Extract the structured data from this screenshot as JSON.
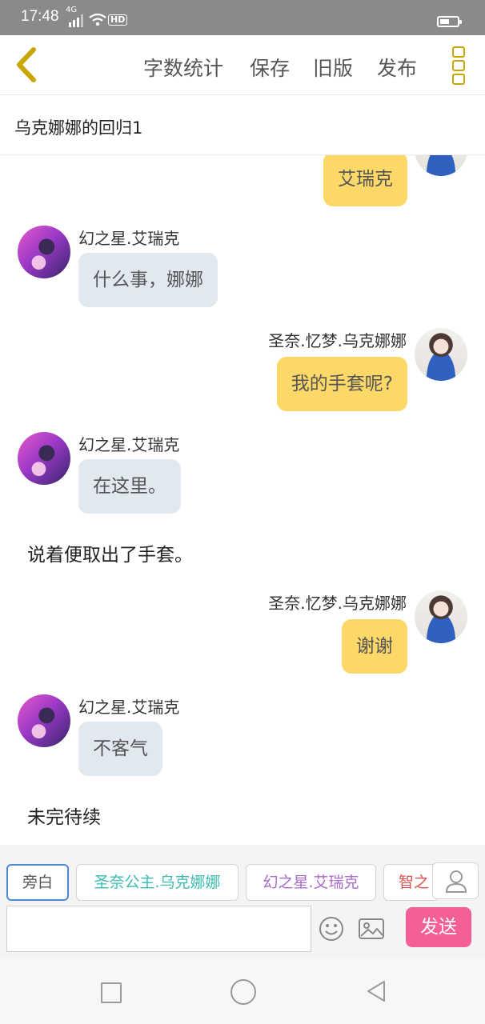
{
  "status": {
    "time": "17:48",
    "network": "4G",
    "hd": "HD",
    "battery_level": 0.55
  },
  "toolbar": {
    "word_count": "字数统计",
    "save": "保存",
    "old_version": "旧版",
    "publish": "发布"
  },
  "story": {
    "title": "乌克娜娜的回归1"
  },
  "messages": [
    {
      "side": "right",
      "name": "",
      "text": "艾瑞克"
    },
    {
      "side": "left",
      "name": "幻之星.艾瑞克",
      "text": "什么事，娜娜"
    },
    {
      "side": "right",
      "name": "圣奈.忆梦.乌克娜娜",
      "text": "我的手套呢?"
    },
    {
      "side": "left",
      "name": "幻之星.艾瑞克",
      "text": "在这里。"
    },
    {
      "side": "narration",
      "text": "说着便取出了手套。"
    },
    {
      "side": "right",
      "name": "圣奈.忆梦.乌克娜娜",
      "text": "谢谢"
    },
    {
      "side": "left",
      "name": "幻之星.艾瑞克",
      "text": "不客气"
    },
    {
      "side": "narration",
      "text": "未完待续"
    }
  ],
  "roles": [
    {
      "label": "旁白",
      "color": "#555555"
    },
    {
      "label": "圣奈公主.乌克娜娜",
      "color": "#3cbcb0"
    },
    {
      "label": "幻之星.艾瑞克",
      "color": "#a96bc9"
    },
    {
      "label": "智之",
      "color": "#e05050"
    }
  ],
  "composer": {
    "placeholder": "",
    "send": "发送"
  }
}
